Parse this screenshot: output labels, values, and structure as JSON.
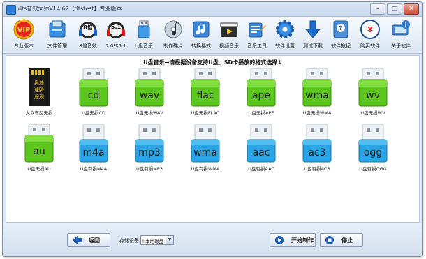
{
  "window": {
    "title": "dts音效大师V14.62【dtstest】专业版本"
  },
  "toolbar": {
    "items": [
      {
        "label": "专业版本",
        "icon": "vip-badge-icon"
      },
      {
        "label": "文件管理",
        "icon": "file-manager-icon"
      },
      {
        "label": "8倍音效",
        "icon": "headphones-8x-icon",
        "badge": "8倍"
      },
      {
        "label": "2.0转5.1",
        "icon": "convert-51-icon",
        "badge": "5.1"
      },
      {
        "label": "U盘音乐",
        "icon": "usb-music-icon"
      },
      {
        "label": "制作碟片",
        "icon": "make-disc-icon"
      },
      {
        "label": "转换格式",
        "icon": "convert-format-icon"
      },
      {
        "label": "视频音乐",
        "icon": "video-music-icon"
      },
      {
        "label": "音乐工具",
        "icon": "music-tools-icon"
      },
      {
        "label": "软件设置",
        "icon": "gear-icon"
      },
      {
        "label": "测试下载",
        "icon": "download-arrow-icon"
      },
      {
        "label": "软件教程",
        "icon": "tutorial-icon"
      },
      {
        "label": "购买软件",
        "icon": "buy-software-icon"
      },
      {
        "label": "关于软件",
        "icon": "about-software-icon"
      }
    ]
  },
  "content": {
    "heading": "U盘音乐→请根据设备支持U盘、SD卡播放的格式选择↓",
    "tiles": [
      {
        "format": "",
        "caption": "大众车型无损",
        "kind": "sdcard",
        "card_text": "奥迪\n速腾\n途观"
      },
      {
        "format": "cd",
        "caption": "U盘无损CD",
        "kind": "green"
      },
      {
        "format": "wav",
        "caption": "U盘无损WAV",
        "kind": "green"
      },
      {
        "format": "flac",
        "caption": "U盘无损FLAC",
        "kind": "green"
      },
      {
        "format": "ape",
        "caption": "U盘无损APE",
        "kind": "green"
      },
      {
        "format": "wma",
        "caption": "U盘无损WMA",
        "kind": "green"
      },
      {
        "format": "wv",
        "caption": "U盘无损WV",
        "kind": "green"
      },
      {
        "format": "au",
        "caption": "U盘无损AU",
        "kind": "green"
      },
      {
        "format": "m4a",
        "caption": "U盘有损M4A",
        "kind": "blue"
      },
      {
        "format": "mp3",
        "caption": "U盘有损MP3",
        "kind": "blue"
      },
      {
        "format": "wma",
        "caption": "U盘有损WMA",
        "kind": "blue"
      },
      {
        "format": "aac",
        "caption": "U盘有损AAC",
        "kind": "blue"
      },
      {
        "format": "ac3",
        "caption": "U盘有损AC3",
        "kind": "blue"
      },
      {
        "format": "ogg",
        "caption": "U盘有损OGG",
        "kind": "blue"
      }
    ]
  },
  "bottom": {
    "back_label": "返回",
    "storage_label": "存储设备",
    "storage_value": "I:本地磁盘",
    "start_label": "开始制作",
    "stop_label": "停止"
  },
  "colors": {
    "green_tile": "#5cc61e",
    "blue_tile": "#2aa4e4",
    "accent": "#1d6fc4"
  }
}
